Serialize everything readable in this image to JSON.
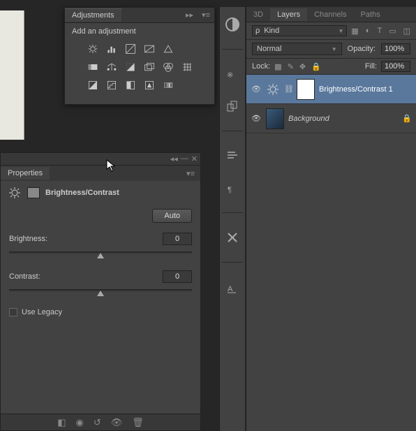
{
  "adjustments": {
    "title": "Adjustments",
    "header": "Add an adjustment"
  },
  "properties": {
    "title": "Properties",
    "type_label": "Brightness/Contrast",
    "auto_label": "Auto",
    "brightness_label": "Brightness:",
    "brightness_value": "0",
    "contrast_label": "Contrast:",
    "contrast_value": "0",
    "legacy_label": "Use Legacy"
  },
  "layers": {
    "tabs": {
      "t3d": "3D",
      "layers": "Layers",
      "channels": "Channels",
      "paths": "Paths"
    },
    "filter_kind": "Kind",
    "filter_search": "ρ",
    "blend_mode": "Normal",
    "opacity_label": "Opacity:",
    "opacity_value": "100%",
    "lock_label": "Lock:",
    "fill_label": "Fill:",
    "fill_value": "100%",
    "items": [
      {
        "name": "Brightness/Contrast 1"
      },
      {
        "name": "Background"
      }
    ]
  }
}
